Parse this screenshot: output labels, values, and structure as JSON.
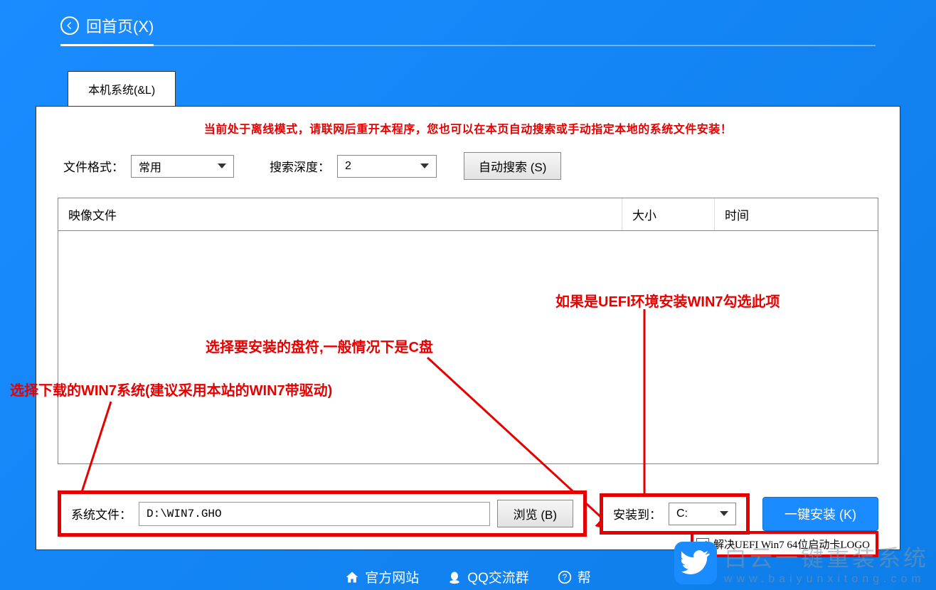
{
  "header": {
    "back_label": "回首页(X)"
  },
  "tab": {
    "label": "本机系统(&L)"
  },
  "warning": "当前处于离线模式，请联网后重开本程序，您也可以在本页自动搜索或手动指定本地的系统文件安装！",
  "filters": {
    "format_label": "文件格式：",
    "format_value": "常用",
    "depth_label": "搜索深度：",
    "depth_value": "2",
    "auto_search_label": "自动搜索 (S)"
  },
  "table": {
    "col_image": "映像文件",
    "col_size": "大小",
    "col_time": "时间"
  },
  "annotations": {
    "uefi_hint": "如果是UEFI环境安装WIN7勾选此项",
    "drive_hint": "选择要安装的盘符,一般情况下是C盘",
    "download_hint": "选择下载的WIN7系统(建议采用本站的WIN7带驱动)"
  },
  "uefi": {
    "checkbox_label": "解决UEFI Win7 64位启动卡LOGO"
  },
  "bottom": {
    "sysfile_label": "系统文件：",
    "sysfile_value": "D:\\WIN7.GHO",
    "browse_label": "浏览 (B)",
    "install_to_label": "安装到：",
    "install_to_value": "C:",
    "install_btn_label": "一键安装 (K)"
  },
  "footer": {
    "site": "官方网站",
    "qq": "QQ交流群",
    "help_partial": "帮"
  },
  "watermark": {
    "title": "白云一键重装系统",
    "url": "www.baiyunxitong.com"
  }
}
